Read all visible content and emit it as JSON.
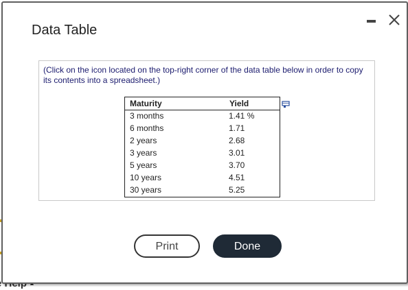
{
  "background": {
    "help_label": "e Help",
    "help_caret": "▲"
  },
  "dialog": {
    "title": "Data Table",
    "minimize_icon": "minimize-icon",
    "close_icon": "close-icon",
    "instructions": "(Click on the icon located on the top-right corner of the data table below in order to copy its contents into a spreadsheet.)",
    "copy_icon": "copy-to-spreadsheet-icon",
    "table": {
      "headers": [
        "Maturity",
        "Yield"
      ],
      "rows": [
        [
          "3 months",
          "1.41 %"
        ],
        [
          "6 months",
          "1.71"
        ],
        [
          "2 years",
          "2.68"
        ],
        [
          "3 years",
          "3.01"
        ],
        [
          "5 years",
          "3.70"
        ],
        [
          "10 years",
          "4.51"
        ],
        [
          "30 years",
          "5.25"
        ]
      ]
    },
    "buttons": {
      "print_label": "Print",
      "done_label": "Done"
    }
  },
  "colors": {
    "done_button": "#1f2a36",
    "instruction_text": "#1b1b6e",
    "copy_icon": "#2a4f9e"
  }
}
